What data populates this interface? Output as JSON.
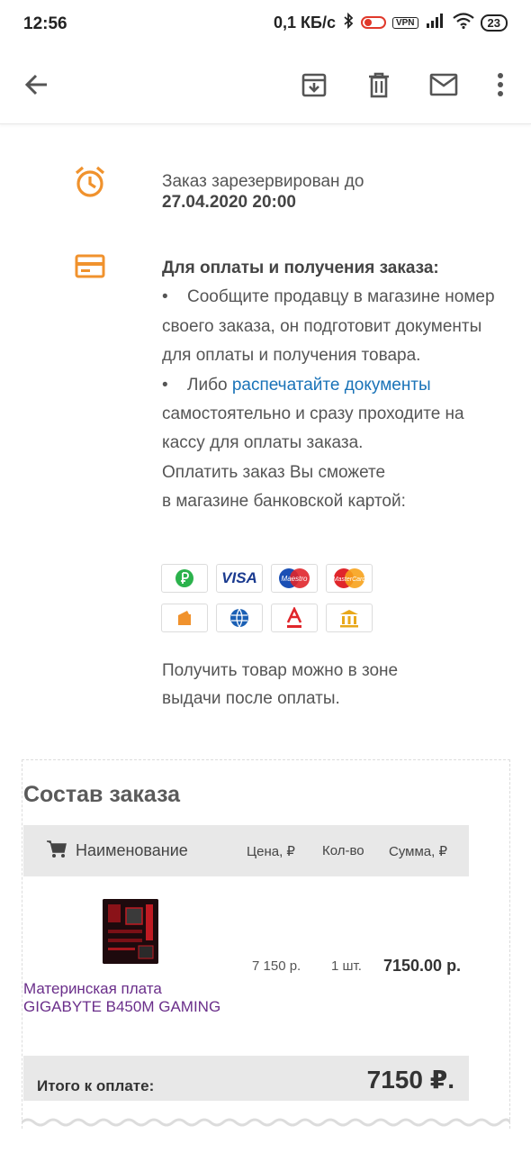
{
  "status_bar": {
    "time": "12:56",
    "speed": "0,1 КБ/с",
    "vpn": "VPN",
    "battery": "23"
  },
  "toolbar": {
    "icons": [
      "back-arrow-icon",
      "archive-icon",
      "delete-icon",
      "mail-icon",
      "more-vert-icon"
    ]
  },
  "reservation": {
    "text": "Заказ зарезервирован до",
    "date": "27.04.2020 20:00"
  },
  "payment": {
    "heading": "Для оплаты и получения заказа:",
    "bullet1": "Сообщите продавцу в магазине номер своего заказа, он подготовит документы для оплаты и получения товара.",
    "bullet2_prefix": "Либо ",
    "bullet2_link": "распечатайте документы",
    "bullet2_suffix": "самостоятельно и сразу проходите на кассу для оплаты заказа.",
    "card_note_1": "Оплатить заказ Вы сможете",
    "card_note_2": "в магазине банковской картой:",
    "cards_row1": [
      "ruble-icon",
      "visa-logo",
      "maestro-logo",
      "mastercard-logo"
    ],
    "cards_row2": [
      "wallet-icon",
      "webmoney-icon",
      "alfa-bank-icon",
      "bank-icon"
    ],
    "visa_text": "VISA",
    "maestro_text": "Maestro",
    "mastercard_text": "MasterCard",
    "receive_1": "Получить товар можно в зоне",
    "receive_2": "выдачи после оплаты."
  },
  "order": {
    "title": "Состав заказа",
    "columns": {
      "name": "Наименование",
      "price": "Цена, ₽",
      "qty": "Кол-во",
      "sum": "Сумма, ₽"
    },
    "items": [
      {
        "name_line1": "Материнская плата",
        "name_line2": "GIGABYTE B450M GAMING",
        "price": "7 150 р.",
        "qty": "1 шт.",
        "sum": "7150.00 р."
      }
    ],
    "total_label": "Итого к оплате:",
    "total_value": "7150 ₽."
  },
  "colors": {
    "accent_orange": "#f0922d",
    "link_blue": "#1a73b8",
    "product_purple": "#6a2e8a"
  }
}
